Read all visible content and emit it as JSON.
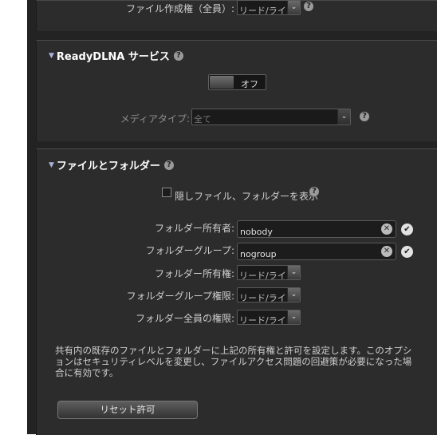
{
  "top": {
    "file_permission_label": "ファイル作成権（全員）:",
    "file_permission_value": "リード/ライト"
  },
  "dlna": {
    "title": "ReadyDLNA サービス",
    "toggle_label": "オフ",
    "media_type_label": "メディアタイプ:",
    "media_type_value": "全て"
  },
  "files": {
    "title": "ファイルとフォルダー",
    "show_hidden_label": "隠しファイル、フォルダーを表示",
    "owner_label": "フォルダー所有者:",
    "owner_value": "nobody",
    "group_label": "フォルダーグループ:",
    "group_value": "nogroup",
    "owner_perm_label": "フォルダー所有権:",
    "owner_perm_value": "リード/ライト",
    "group_perm_label": "フォルダーグループ権限:",
    "group_perm_value": "リード/ライト",
    "everyone_perm_label": "フォルダー全員の権限:",
    "everyone_perm_value": "リード/ライト",
    "info_text": "共有内の既存のファイルとフォルダーに上記の所有権と許可を設定します。このオプションはセキュリティレベルを変更し、ファイルアクセス問題の回避策が必要になった場合に有効です。",
    "reset_button": "リセット許可"
  },
  "icons": {
    "help": "help-icon",
    "clear": "clear-icon",
    "confirm": "checkmark-icon",
    "expand": "triangle-down-icon",
    "dropdown": "chevron-down-icon"
  }
}
